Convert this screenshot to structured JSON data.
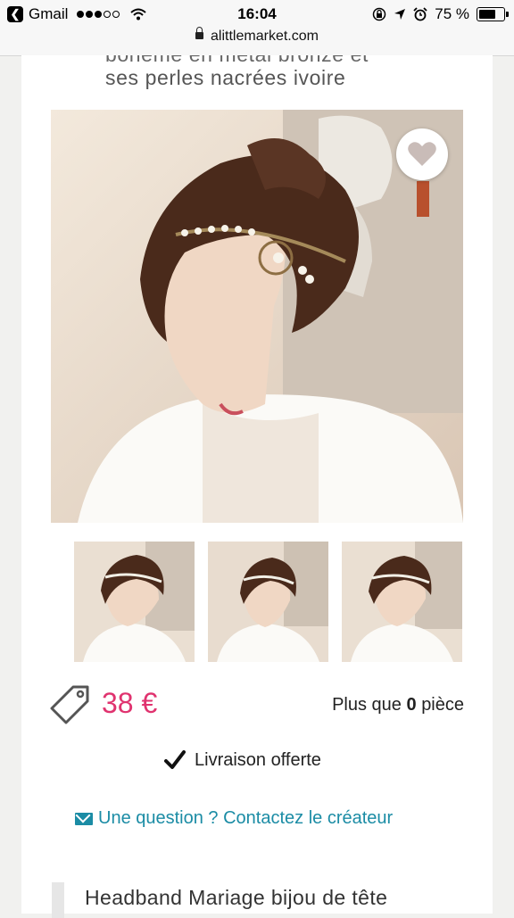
{
  "status_bar": {
    "back_app": "Gmail",
    "time": "16:04",
    "battery": "75 %",
    "battery_level": 0.75
  },
  "url_bar": {
    "domain": "alittlemarket.com"
  },
  "product": {
    "title_line1": "bohème en métal bronze et",
    "title_line2": "ses perles nacrées ivoire",
    "price": "38 €",
    "stock_prefix": "Plus que",
    "stock_count": "0",
    "stock_suffix": "pièce",
    "delivery": "Livraison offerte",
    "contact": "Une question ? Contactez le créateur",
    "section_title": "Headband Mariage bijou de tête"
  },
  "icons": {
    "back": "back-chevron-icon",
    "wifi": "wifi-icon",
    "lock": "lock-icon",
    "favorite": "heart-icon",
    "price_tag": "tag-icon",
    "check": "checkmark-icon",
    "mail": "mail-icon"
  },
  "colors": {
    "price": "#e0336f",
    "link": "#1b8ca5",
    "favorite_heart": "#c9bcb8"
  }
}
